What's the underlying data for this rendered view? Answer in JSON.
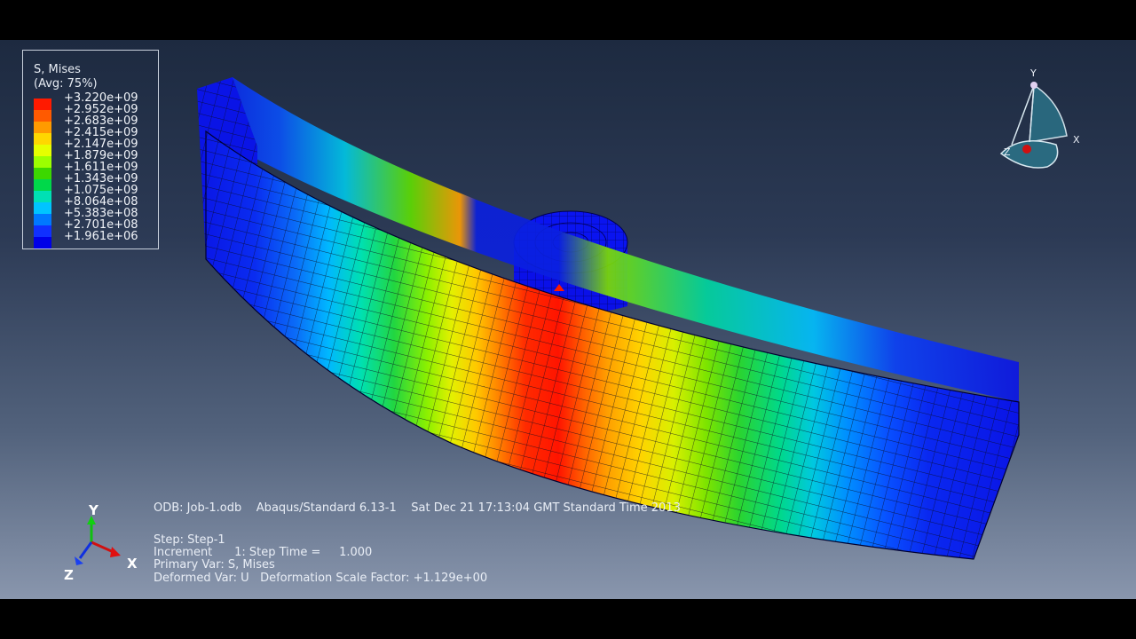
{
  "legend": {
    "title": "S, Mises",
    "subtitle": "(Avg: 75%)",
    "levels": [
      {
        "value": "+3.220e+09",
        "color": "#ff1a00"
      },
      {
        "value": "+2.952e+09",
        "color": "#ff5a00"
      },
      {
        "value": "+2.683e+09",
        "color": "#ff9a00"
      },
      {
        "value": "+2.415e+09",
        "color": "#ffd700"
      },
      {
        "value": "+2.147e+09",
        "color": "#e6ff00"
      },
      {
        "value": "+1.879e+09",
        "color": "#9cff00"
      },
      {
        "value": "+1.611e+09",
        "color": "#3cd800"
      },
      {
        "value": "+1.343e+09",
        "color": "#00d84a"
      },
      {
        "value": "+1.075e+09",
        "color": "#00e0b4"
      },
      {
        "value": "+8.064e+08",
        "color": "#00c4ff"
      },
      {
        "value": "+5.383e+08",
        "color": "#0078ff"
      },
      {
        "value": "+2.701e+08",
        "color": "#1030ff"
      },
      {
        "value": "+1.961e+06",
        "color": "#0000e8"
      }
    ]
  },
  "info": {
    "odb_line": "ODB: Job-1.odb    Abaqus/Standard 6.13-1    Sat Dec 21 17:13:04 GMT Standard Time 2013",
    "step_line": "Step: Step-1",
    "increment_line": "Increment      1: Step Time =     1.000",
    "primary_var_line": "Primary Var: S, Mises",
    "deformed_var_line": "Deformed Var: U   Deformation Scale Factor: +1.129e+00"
  },
  "triad": {
    "x": "X",
    "y": "Y",
    "z": "Z"
  },
  "view_cube": {
    "x": "X",
    "y": "Y",
    "z": "Z"
  }
}
